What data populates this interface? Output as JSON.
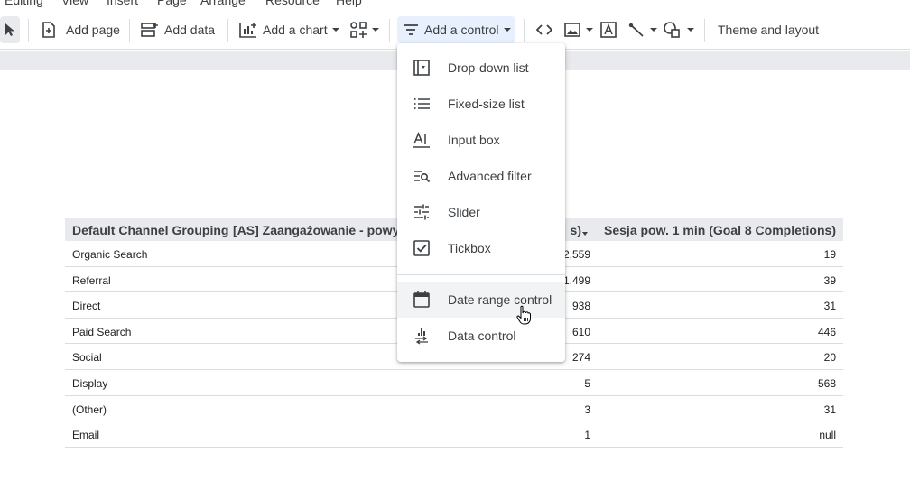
{
  "menubar": {
    "items": [
      "Editing",
      "View",
      "Insert",
      "Page",
      "Arrange",
      "Resource",
      "Help"
    ]
  },
  "toolbar": {
    "add_page": "Add page",
    "add_data": "Add data",
    "add_chart": "Add a chart",
    "add_control": "Add a control",
    "theme_layout": "Theme and layout"
  },
  "dropdown": {
    "items": [
      {
        "label": "Drop-down list",
        "icon": "dropdown-list-icon"
      },
      {
        "label": "Fixed-size list",
        "icon": "fixed-list-icon"
      },
      {
        "label": "Input box",
        "icon": "input-box-icon"
      },
      {
        "label": "Advanced filter",
        "icon": "advanced-filter-icon"
      },
      {
        "label": "Slider",
        "icon": "slider-icon"
      },
      {
        "label": "Tickbox",
        "icon": "checkbox-icon"
      },
      {
        "label": "Date range control",
        "icon": "calendar-icon"
      },
      {
        "label": "Data control",
        "icon": "data-control-icon"
      }
    ]
  },
  "table": {
    "headers": [
      "Default Channel Grouping",
      "[AS] Zaangażowanie - powyże",
      "s)",
      "Sesja pow. 1 min (Goal 8 Completions)"
    ],
    "rows": [
      [
        "Organic Search",
        "2,559",
        "19"
      ],
      [
        "Referral",
        "1,499",
        "39"
      ],
      [
        "Direct",
        "938",
        "31"
      ],
      [
        "Paid Search",
        "610",
        "446"
      ],
      [
        "Social",
        "274",
        "20"
      ],
      [
        "Display",
        "5",
        "568"
      ],
      [
        "(Other)",
        "3",
        "31"
      ],
      [
        "Email",
        "1",
        "null"
      ]
    ]
  },
  "colors": {
    "accent": "#1a73e8",
    "active_bg": "#e8f0fe",
    "header_bg": "#e8eaed"
  }
}
